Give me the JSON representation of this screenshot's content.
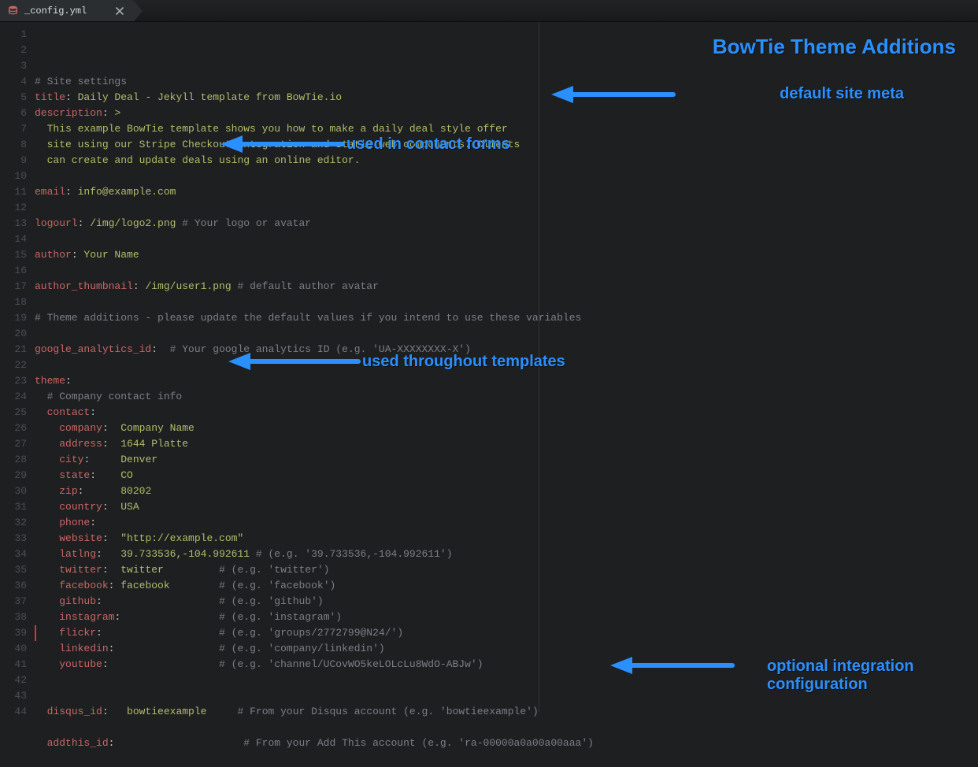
{
  "tab": {
    "filename": "_config.yml",
    "icon": "database-icon"
  },
  "annotations": {
    "title": "BowTie Theme Additions",
    "meta": "default site meta",
    "contact": "used in contact forms",
    "theme": "used throughout templates",
    "integration_line1": "optional integration",
    "integration_line2": "configuration"
  },
  "code": {
    "lines": [
      {
        "n": 1,
        "t": "comment",
        "text": "# Site settings"
      },
      {
        "n": 2,
        "t": "kv",
        "key": "title",
        "value": "Daily Deal - Jekyll template from BowTie.io"
      },
      {
        "n": 3,
        "t": "kv",
        "key": "description",
        "value": ">"
      },
      {
        "n": 4,
        "t": "plain",
        "text": "  This example BowTie template shows you how to make a daily deal style offer"
      },
      {
        "n": 5,
        "t": "plain",
        "text": "  site using our Stripe Checkout integration and static web components. Clients"
      },
      {
        "n": 6,
        "t": "plain",
        "text": "  can create and update deals using an online editor."
      },
      {
        "n": 7,
        "t": "blank"
      },
      {
        "n": 8,
        "t": "kv",
        "key": "email",
        "value": "info@example.com"
      },
      {
        "n": 9,
        "t": "blank"
      },
      {
        "n": 10,
        "t": "kvc",
        "key": "logourl",
        "value": "/img/logo2.png",
        "comment": "# Your logo or avatar"
      },
      {
        "n": 11,
        "t": "blank"
      },
      {
        "n": 12,
        "t": "kv",
        "key": "author",
        "value": "Your Name"
      },
      {
        "n": 13,
        "t": "blank"
      },
      {
        "n": 14,
        "t": "kvc",
        "key": "author_thumbnail",
        "value": "/img/user1.png",
        "comment": "# default author avatar"
      },
      {
        "n": 15,
        "t": "blank"
      },
      {
        "n": 16,
        "t": "comment",
        "text": "# Theme additions - please update the default values if you intend to use these variables"
      },
      {
        "n": 17,
        "t": "blank"
      },
      {
        "n": 18,
        "t": "kvc",
        "key": "google_analytics_id",
        "value": "",
        "comment": "# Your google analytics ID (e.g. 'UA-XXXXXXXX-X')"
      },
      {
        "n": 19,
        "t": "blank"
      },
      {
        "n": 20,
        "t": "keyonly",
        "key": "theme"
      },
      {
        "n": 21,
        "t": "comment",
        "text": "  # Company contact info"
      },
      {
        "n": 22,
        "t": "keyonly",
        "indent": "  ",
        "key": "contact"
      },
      {
        "n": 23,
        "t": "kv",
        "indent": "    ",
        "key": "company",
        "pad": "  ",
        "value": "Company Name"
      },
      {
        "n": 24,
        "t": "kv",
        "indent": "    ",
        "key": "address",
        "pad": "  ",
        "value": "1644 Platte"
      },
      {
        "n": 25,
        "t": "kv",
        "indent": "    ",
        "key": "city",
        "pad": "     ",
        "value": "Denver"
      },
      {
        "n": 26,
        "t": "kv",
        "indent": "    ",
        "key": "state",
        "pad": "    ",
        "value": "CO"
      },
      {
        "n": 27,
        "t": "kv",
        "indent": "    ",
        "key": "zip",
        "pad": "      ",
        "value": "80202"
      },
      {
        "n": 28,
        "t": "kv",
        "indent": "    ",
        "key": "country",
        "pad": "  ",
        "value": "USA"
      },
      {
        "n": 29,
        "t": "keyonly",
        "indent": "    ",
        "key": "phone"
      },
      {
        "n": 30,
        "t": "kv",
        "indent": "    ",
        "key": "website",
        "pad": "  ",
        "value": "\"http://example.com\""
      },
      {
        "n": 31,
        "t": "kvc",
        "indent": "    ",
        "key": "latlng",
        "pad": "   ",
        "value": "39.733536,-104.992611",
        "comment": "# (e.g. '39.733536,-104.992611')"
      },
      {
        "n": 32,
        "t": "kvc",
        "indent": "    ",
        "key": "twitter",
        "pad": "  ",
        "value": "twitter",
        "cpad": "         ",
        "comment": "# (e.g. 'twitter')"
      },
      {
        "n": 33,
        "t": "kvc",
        "indent": "    ",
        "key": "facebook",
        "pad": " ",
        "value": "facebook",
        "cpad": "        ",
        "comment": "# (e.g. 'facebook')"
      },
      {
        "n": 34,
        "t": "kvc",
        "indent": "    ",
        "key": "github",
        "pad": "",
        "value": "",
        "cpad": "                  ",
        "comment": "# (e.g. 'github')"
      },
      {
        "n": 35,
        "t": "kvc",
        "indent": "    ",
        "key": "instagram",
        "pad": "",
        "value": "",
        "cpad": "               ",
        "comment": "# (e.g. 'instagram')"
      },
      {
        "n": 36,
        "t": "kvc",
        "indent": "    ",
        "key": "flickr",
        "pad": "",
        "value": "",
        "cpad": "                  ",
        "comment": "# (e.g. 'groups/2772799@N24/')"
      },
      {
        "n": 37,
        "t": "kvc",
        "indent": "    ",
        "key": "linkedin",
        "pad": "",
        "value": "",
        "cpad": "                ",
        "comment": "# (e.g. 'company/linkedin')"
      },
      {
        "n": 38,
        "t": "kvc",
        "indent": "    ",
        "key": "youtube",
        "pad": "",
        "value": "",
        "cpad": "                 ",
        "comment": "# (e.g. 'channel/UCovWO5keLOLcLu8WdO-ABJw')"
      },
      {
        "n": 39,
        "t": "blank"
      },
      {
        "n": 40,
        "t": "blank"
      },
      {
        "n": 41,
        "t": "kvc",
        "indent": "  ",
        "key": "disqus_id",
        "pad": "   ",
        "value": "bowtieexample",
        "cpad": "     ",
        "comment": "# From your Disqus account (e.g. 'bowtieexample')"
      },
      {
        "n": 42,
        "t": "blank"
      },
      {
        "n": 43,
        "t": "kvc",
        "indent": "  ",
        "key": "addthis_id",
        "pad": "",
        "value": "",
        "cpad": "                    ",
        "comment": "# From your Add This account (e.g. 'ra-00000a0a00a00aaa')"
      },
      {
        "n": 44,
        "t": "blank"
      }
    ]
  }
}
